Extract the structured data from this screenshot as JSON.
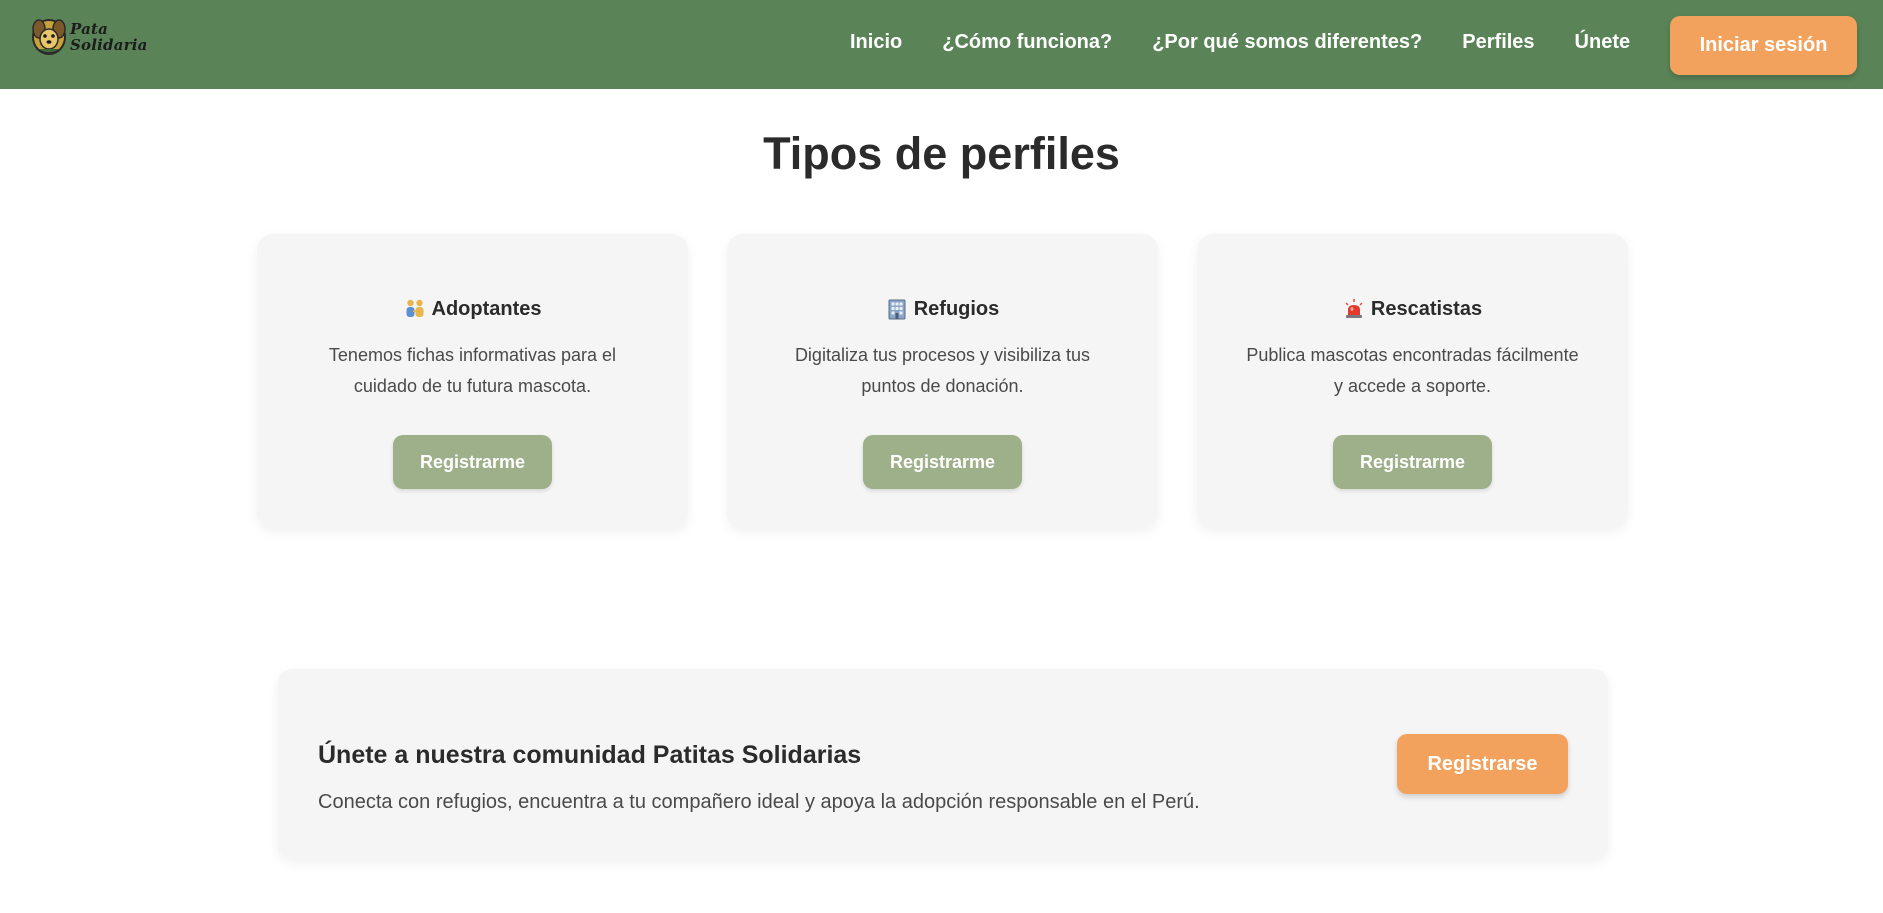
{
  "brand": {
    "logo_line1": "Pata",
    "logo_line2": "Solidaria"
  },
  "nav": {
    "links": [
      "Inicio",
      "¿Cómo funciona?",
      "¿Por qué somos diferentes?",
      "Perfiles",
      "Únete"
    ],
    "login_label": "Iniciar sesión"
  },
  "profiles": {
    "title": "Tipos de perfiles",
    "cards": [
      {
        "icon": "people-holding-hands-icon",
        "title": "Adoptantes",
        "description": "Tenemos fichas informativas para el cuidado de tu futura mascota.",
        "button": "Registrarme"
      },
      {
        "icon": "office-building-icon",
        "title": "Refugios",
        "description": "Digitaliza tus procesos y visibiliza tus puntos de donación.",
        "button": "Registrarme"
      },
      {
        "icon": "police-siren-icon",
        "title": "Rescatistas",
        "description": "Publica mascotas encontradas fácilmente y accede a soporte.",
        "button": "Registrarme"
      }
    ]
  },
  "join": {
    "title": "Únete a nuestra comunidad Patitas Solidarias",
    "description": "Conecta con refugios, encuentra a tu compañero ideal y apoya la adopción responsable en el Perú.",
    "button": "Registrarse"
  },
  "colors": {
    "header_bg": "#5a8457",
    "accent_orange": "#f2a25d",
    "button_green": "#9eb08a",
    "card_bg": "#f5f5f5"
  }
}
